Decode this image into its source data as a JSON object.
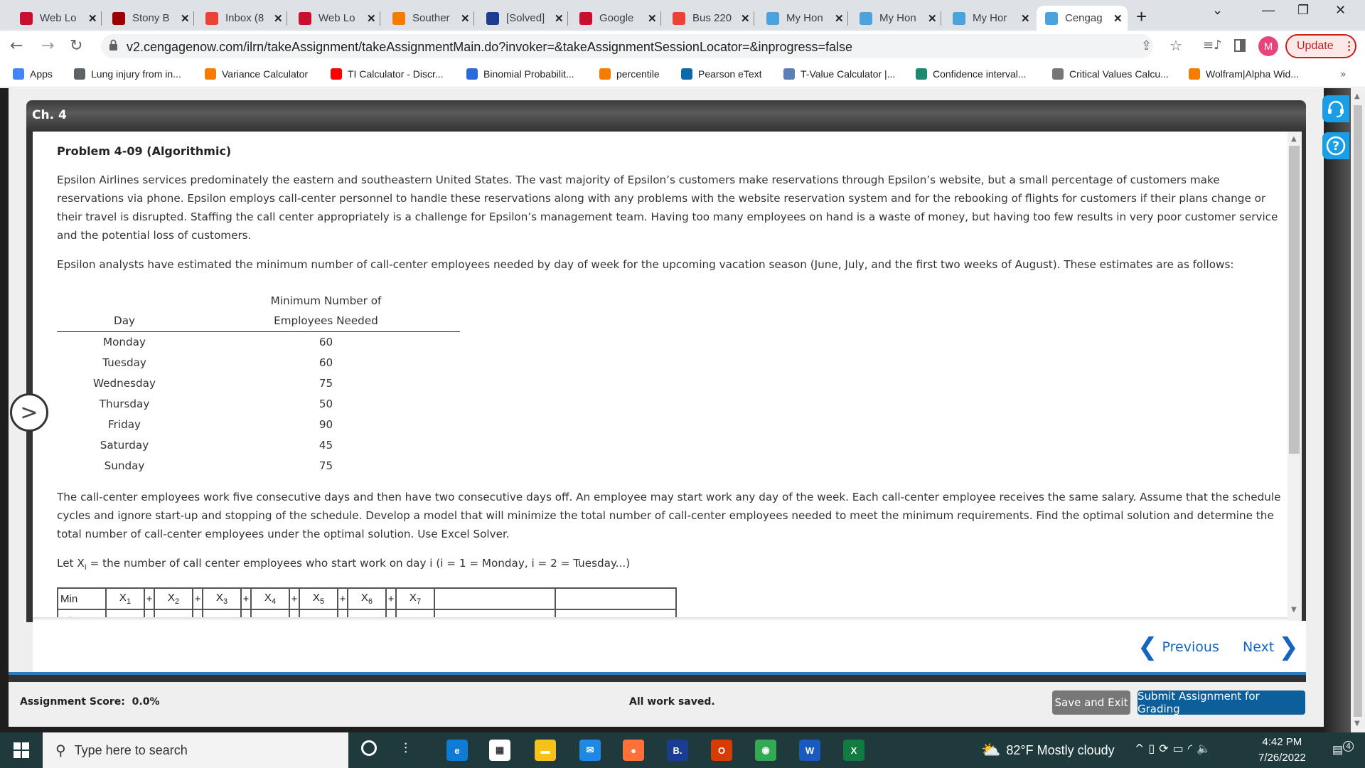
{
  "browser": {
    "tabs": [
      {
        "title": "Web Lo",
        "icon": "shield-red-icon",
        "color": "#c8102e"
      },
      {
        "title": "Stony B",
        "icon": "shield-red-icon",
        "color": "#990000"
      },
      {
        "title": "Inbox (8",
        "icon": "gmail-icon",
        "color": "#ea4335"
      },
      {
        "title": "Web Lo",
        "icon": "shield-red-icon",
        "color": "#c8102e"
      },
      {
        "title": "Souther",
        "icon": "c-orange-icon",
        "color": "#f57c00"
      },
      {
        "title": "[Solved]",
        "icon": "star-blue-icon",
        "color": "#1a3d8f"
      },
      {
        "title": "Google",
        "icon": "shield-red-icon",
        "color": "#c8102e"
      },
      {
        "title": "Bus 220",
        "icon": "gmail-icon",
        "color": "#ea4335"
      },
      {
        "title": "My Hon",
        "icon": "cengage-icon",
        "color": "#4aa3df"
      },
      {
        "title": "My Hon",
        "icon": "cengage-icon",
        "color": "#4aa3df"
      },
      {
        "title": "My Hor",
        "icon": "cengage-icon",
        "color": "#4aa3df"
      },
      {
        "title": "Cengag",
        "icon": "cengage-icon",
        "color": "#4aa3df",
        "active": true
      }
    ],
    "url": "v2.cengagenow.com/ilrn/takeAssignment/takeAssignmentMain.do?invoker=&takeAssignmentSessionLocator=&inprogress=false",
    "avatar_letter": "M",
    "update_label": "Update",
    "bookmarks": [
      {
        "label": "Apps",
        "color": "#4285f4"
      },
      {
        "label": "Lung injury from in...",
        "color": "#5f6368"
      },
      {
        "label": "Variance Calculator",
        "color": "#f57c00"
      },
      {
        "label": "TI Calculator - Discr...",
        "color": "#ff0000"
      },
      {
        "label": "Binomial Probabilit...",
        "color": "#2a6ad9"
      },
      {
        "label": "percentile",
        "color": "#f57c00"
      },
      {
        "label": "Pearson eText",
        "color": "#0d6aa8"
      },
      {
        "label": "T-Value Calculator |...",
        "color": "#5b7fb5"
      },
      {
        "label": "Confidence interval...",
        "color": "#1d8a6e"
      },
      {
        "label": "Critical Values Calcu...",
        "color": "#777777"
      },
      {
        "label": "Wolfram|Alpha Wid...",
        "color": "#f57c00"
      }
    ],
    "bookmarks_more": "»"
  },
  "assignment": {
    "chapter": "Ch. 4",
    "problem_title": "Problem 4-09 (Algorithmic)",
    "paragraph1": "Epsilon Airlines services predominately the eastern and southeastern United States. The vast majority of Epsilon’s customers make reservations through Epsilon’s website, but a small percentage of customers make reservations via phone. Epsilon employs call-center personnel to handle these reservations along with any problems with the website reservation system and for the rebooking of flights for customers if their plans change or their travel is disrupted. Staffing the call center appropriately is a challenge for Epsilon’s management team. Having too many employees on hand is a waste of money, but having too few results in very poor customer service and the potential loss of customers.",
    "paragraph2": "Epsilon analysts have estimated the minimum number of call-center employees needed by day of week for the upcoming vacation season (June, July, and the first two weeks of August). These estimates are as follows:",
    "table": {
      "col_day": "Day",
      "col_min_line1": "Minimum Number of",
      "col_min_line2": "Employees Needed",
      "rows": [
        {
          "day": "Monday",
          "min": "60"
        },
        {
          "day": "Tuesday",
          "min": "60"
        },
        {
          "day": "Wednesday",
          "min": "75"
        },
        {
          "day": "Thursday",
          "min": "50"
        },
        {
          "day": "Friday",
          "min": "90"
        },
        {
          "day": "Saturday",
          "min": "45"
        },
        {
          "day": "Sunday",
          "min": "75"
        }
      ]
    },
    "paragraph3": "The call-center employees work five consecutive days and then have two consecutive days off. An employee may start work any day of the week. Each call-center employee receives the same salary. Assume that the schedule cycles and ignore start-up and stopping of the schedule. Develop a model that will minimize the total number of call-center employees needed to meet the minimum requirements. Find the optimal solution and determine the total number of call-center employees under the optimal solution. Use Excel Solver.",
    "paragraph4_prefix": "Let X",
    "paragraph4_sub": "i",
    "paragraph4_suffix": " = the number of call center employees who start work on day i (i = 1 = Monday, i = 2 = Tuesday...)",
    "model": {
      "row1_label": "Min",
      "variables": [
        "X1",
        "X2",
        "X3",
        "X4",
        "X5",
        "X6",
        "X7"
      ],
      "operator": "+",
      "row2_label": "s.t."
    }
  },
  "nav": {
    "previous_label": "Previous",
    "next_label": "Next"
  },
  "footer": {
    "score_label": "Assignment Score:",
    "score_value": "0.0%",
    "status": "All work saved.",
    "save_exit_label": "Save and Exit",
    "submit_label": "Submit Assignment for Grading"
  },
  "taskbar": {
    "search_placeholder": "Type here to search",
    "weather": "82°F  Mostly cloudy",
    "time": "4:42 PM",
    "date": "7/26/2022",
    "notification_count": "4",
    "apps": [
      {
        "name": "edge",
        "label": "e",
        "color": "#0f7bd5"
      },
      {
        "name": "store",
        "label": "▦",
        "color": "#ffffff"
      },
      {
        "name": "explorer",
        "label": "▬",
        "color": "#f4c21b"
      },
      {
        "name": "mail",
        "label": "✉",
        "color": "#1e88e5"
      },
      {
        "name": "firefox",
        "label": "●",
        "color": "#ff7139"
      },
      {
        "name": "b-app",
        "label": "B.",
        "color": "#1a3d8f"
      },
      {
        "name": "office",
        "label": "O",
        "color": "#d83b01"
      },
      {
        "name": "chrome",
        "label": "◉",
        "color": "#34a853"
      },
      {
        "name": "word",
        "label": "W",
        "color": "#185abd"
      },
      {
        "name": "excel",
        "label": "X",
        "color": "#107c41"
      }
    ]
  }
}
